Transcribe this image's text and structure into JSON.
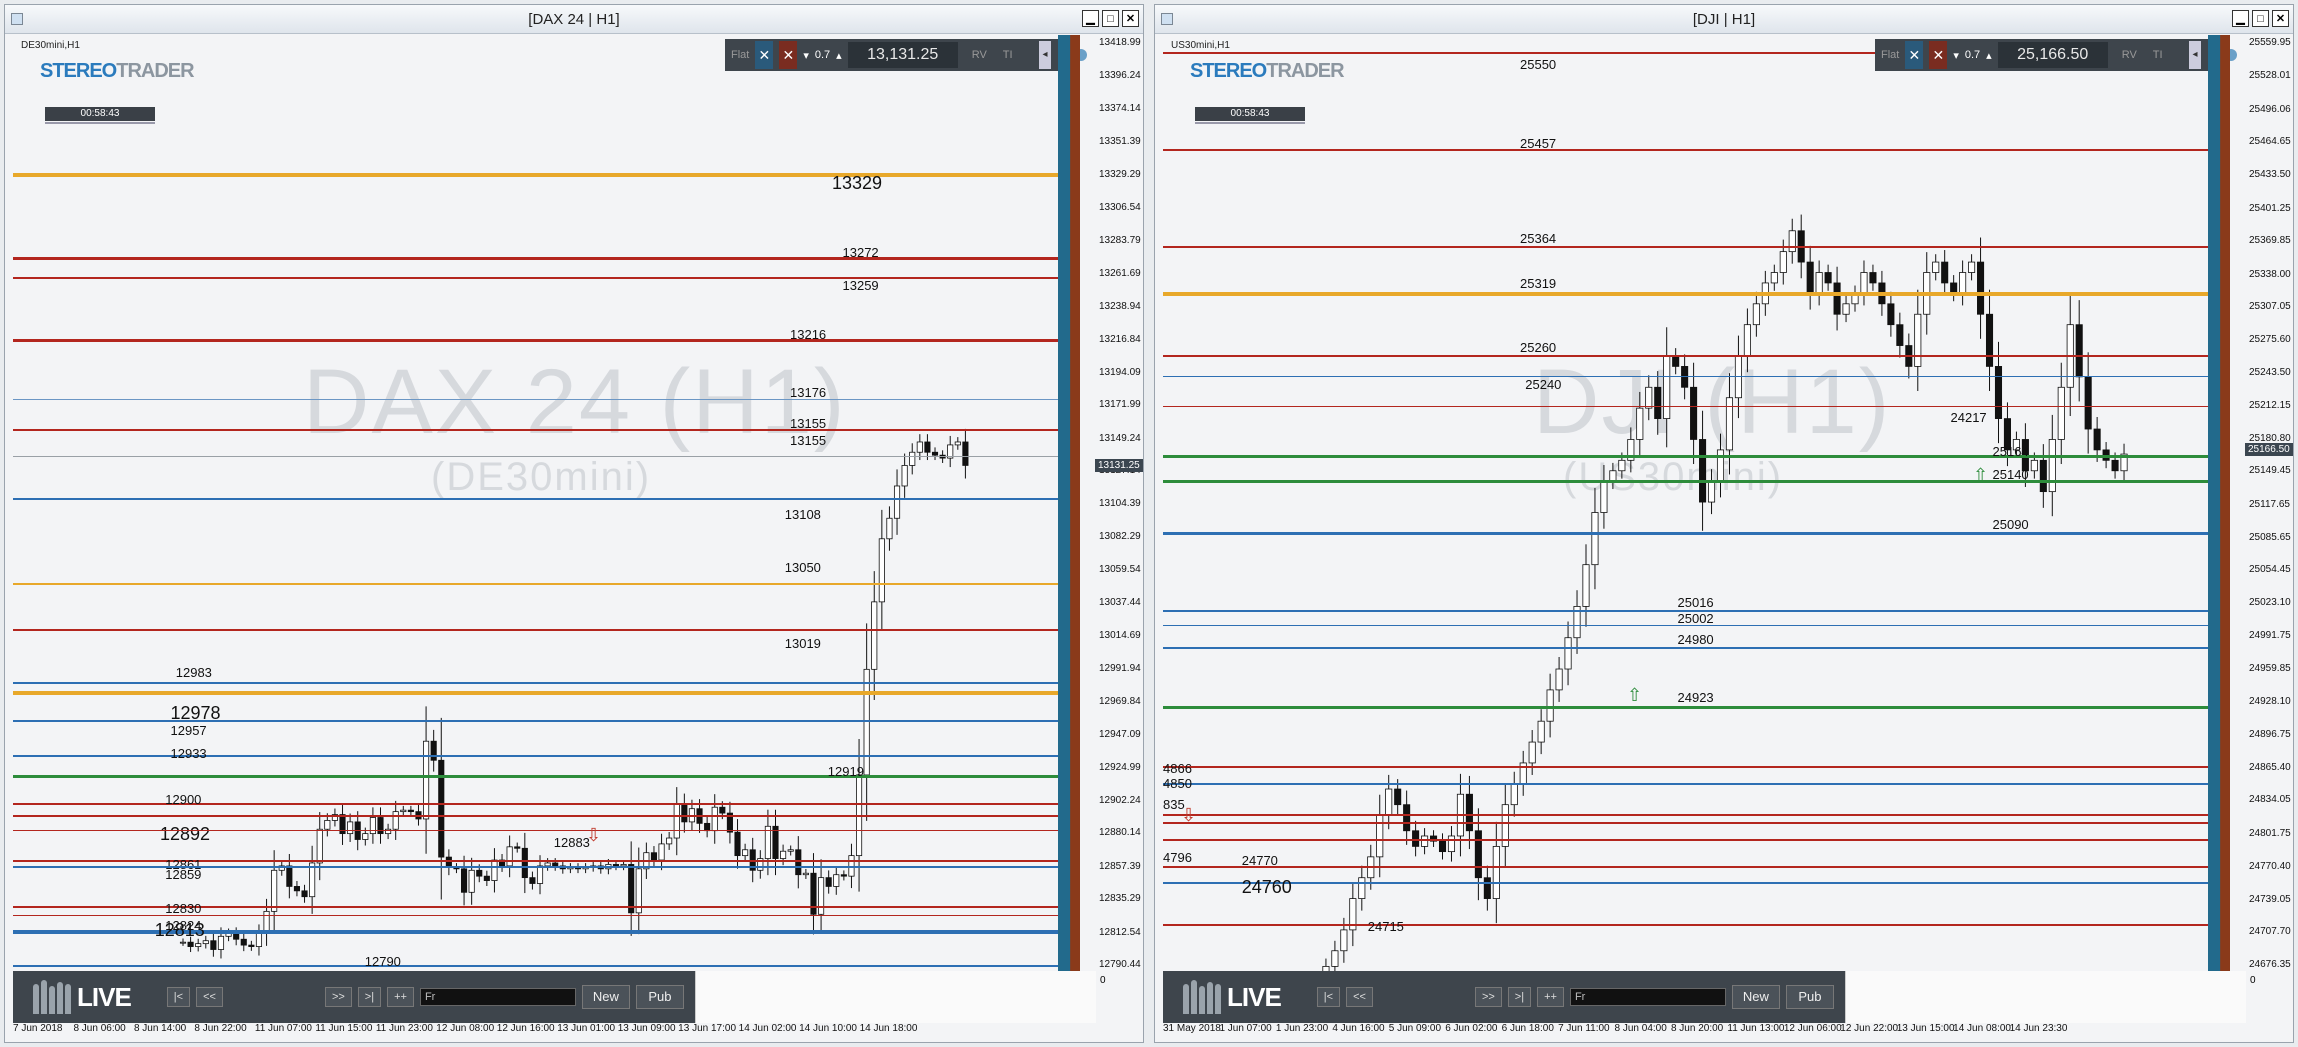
{
  "left": {
    "title": "[DAX 24 | H1]",
    "symbol_label": "DE30mini,H1",
    "watermark_main": "DAX 24 (H1)",
    "watermark_sub": "(DE30mini)",
    "timer": "00:58:43",
    "toolbar": {
      "flat": "Flat",
      "lot": "0.7",
      "price": "13,131.25",
      "rv": "RV",
      "tl": "TI"
    },
    "current_price_tag": "13131.25",
    "bottom": {
      "new": "New",
      "pub": "Pub",
      "field": "Fr",
      "live": "LIVE",
      "nav": [
        "|<",
        "<<",
        ">>",
        ">|",
        "++"
      ]
    },
    "levels": [
      {
        "label": "13329",
        "price": 13329,
        "color": "#e8a82a",
        "width": 4,
        "labelx": 0.78,
        "big": true,
        "ldy": -2
      },
      {
        "label": "13272",
        "price": 13272,
        "color": "#b3261e",
        "width": 3,
        "labelx": 0.79,
        "ldy": -14
      },
      {
        "label": "13259",
        "price": 13259,
        "color": "#b3261e",
        "width": 2,
        "labelx": 0.79,
        "ldy": 0
      },
      {
        "label": "13216",
        "price": 13216,
        "color": "#b3261e",
        "width": 3,
        "labelx": 0.74,
        "ldy": -14
      },
      {
        "label": "13176",
        "price": 13176,
        "color": "#6b96c4",
        "width": 1,
        "labelx": 0.74,
        "ldy": -14
      },
      {
        "label": "13155",
        "price": 13155,
        "color": "#b3261e",
        "width": 2,
        "labelx": 0.74,
        "ldy": -14
      },
      {
        "label": "13155",
        "price": 13137,
        "color": "#9aa0a6",
        "width": 1,
        "labelx": 0.74,
        "ldy": -24
      },
      {
        "label": "13108",
        "price": 13108,
        "color": "#2d6fb3",
        "width": 2,
        "labelx": 0.735,
        "ldy": 8
      },
      {
        "label": "13050",
        "price": 13050,
        "color": "#e8a82a",
        "width": 2,
        "labelx": 0.735,
        "ldy": -24
      },
      {
        "label": "13019",
        "price": 13019,
        "color": "#b3261e",
        "width": 2,
        "labelx": 0.735,
        "ldy": 6
      },
      {
        "label": "12983",
        "price": 12983,
        "color": "#2d6fb3",
        "width": 2,
        "labelx": 0.155,
        "ldy": -18
      },
      {
        "label": "12978",
        "price": 12976,
        "color": "#e8a82a",
        "width": 4,
        "labelx": 0.15,
        "big": true,
        "ldy": 10
      },
      {
        "label": "12957",
        "price": 12957,
        "color": "#2d6fb3",
        "width": 2,
        "labelx": 0.15,
        "ldy": 2
      },
      {
        "label": "12933",
        "price": 12933,
        "color": "#2d6fb3",
        "width": 2,
        "labelx": 0.15,
        "ldy": -10
      },
      {
        "label": "12919",
        "price": 12919,
        "color": "#2d8c3b",
        "width": 3,
        "labelx": 0.776,
        "ldy": -12
      },
      {
        "label": "12900",
        "price": 12900,
        "color": "#b3261e",
        "width": 2,
        "labelx": 0.145,
        "ldy": -12
      },
      {
        "label": "12892",
        "price": 12892,
        "color": "#b3261e",
        "width": 2,
        "labelx": 0.14,
        "big": true,
        "ldy": 8
      },
      {
        "label": "12883",
        "price": 12882,
        "color": "#b3261e",
        "width": 1,
        "labelx": 0.515,
        "ldy": 4
      },
      {
        "label": "12861",
        "price": 12861,
        "color": "#b3261e",
        "width": 2,
        "labelx": 0.145,
        "ldy": -4
      },
      {
        "label": "12859",
        "price": 12857,
        "color": "#2d6fb3",
        "width": 2,
        "labelx": 0.145,
        "ldy": 0
      },
      {
        "label": "12830",
        "price": 12830,
        "color": "#b3261e",
        "width": 2,
        "labelx": 0.145,
        "ldy": -6
      },
      {
        "label": "12824",
        "price": 12824,
        "color": "#b3261e",
        "width": 1,
        "labelx": 0.145,
        "ldy": 2
      },
      {
        "label": "12813",
        "price": 12813,
        "color": "#2d6fb3",
        "width": 4,
        "labelx": 0.135,
        "big": true,
        "ldy": -12
      },
      {
        "label": "12790",
        "price": 12790,
        "color": "#2d6fb3",
        "width": 2,
        "labelx": 0.335,
        "ldy": -12
      }
    ],
    "yaxis": [
      "13418.99",
      "13396.24",
      "13374.14",
      "13351.39",
      "13329.29",
      "13306.54",
      "13283.79",
      "13261.69",
      "13238.94",
      "13216.84",
      "13194.09",
      "13171.99",
      "13149.24",
      "13127.14",
      "13104.39",
      "13082.29",
      "13059.54",
      "13037.44",
      "13014.69",
      "12991.94",
      "12969.84",
      "12947.09",
      "12924.99",
      "12902.24",
      "12880.14",
      "12857.39",
      "12835.29",
      "12812.54",
      "12790.44"
    ],
    "xaxis": [
      "7 Jun 2018",
      "8 Jun 06:00",
      "8 Jun 14:00",
      "8 Jun 22:00",
      "11 Jun 07:00",
      "11 Jun 15:00",
      "11 Jun 23:00",
      "12 Jun 08:00",
      "12 Jun 16:00",
      "13 Jun 01:00",
      "13 Jun 09:00",
      "13 Jun 17:00",
      "14 Jun 02:00",
      "14 Jun 10:00",
      "14 Jun 18:00"
    ],
    "candles": [
      12806,
      12803,
      12805,
      12807,
      12801,
      12810,
      12812,
      12808,
      12804,
      12803,
      12812,
      12827,
      12855,
      12858,
      12844,
      12841,
      12837,
      12860,
      12883,
      12889,
      12893,
      12880,
      12888,
      12876,
      12880,
      12891,
      12880,
      12883,
      12895,
      12896,
      12895,
      12890,
      12943,
      12930,
      12864,
      12857,
      12856,
      12840,
      12855,
      12851,
      12848,
      12862,
      12858,
      12871,
      12870,
      12850,
      12846,
      12858,
      12860,
      12858,
      12856,
      12857,
      12856,
      12857,
      12858,
      12856,
      12859,
      12858,
      12859,
      12826,
      12856,
      12867,
      12862,
      12873,
      12877,
      12900,
      12888,
      12897,
      12887,
      12882,
      12898,
      12894,
      12881,
      12865,
      12869,
      12855,
      12863,
      12885,
      12863,
      12868,
      12869,
      12852,
      12853,
      12825,
      12850,
      12844,
      12852,
      12851,
      12865,
      12920,
      12992,
      13038,
      13081,
      13095,
      13117,
      13131,
      13140,
      13147,
      13140,
      13138,
      13136,
      13145,
      13147,
      13131
    ]
  },
  "right": {
    "title": "[DJI | H1]",
    "symbol_label": "US30mini,H1",
    "watermark_main": "DJI (H1)",
    "watermark_sub": "(US30mini)",
    "timer": "00:58:43",
    "toolbar": {
      "flat": "Flat",
      "lot": "0.7",
      "price": "25,166.50",
      "rv": "RV",
      "tl": "TI"
    },
    "current_price_tag": "25166.50",
    "bottom": {
      "new": "New",
      "pub": "Pub",
      "field": "Fr",
      "live": "LIVE",
      "nav": [
        "|<",
        "<<",
        ">>",
        ">|",
        "++"
      ]
    },
    "levels": [
      {
        "label": "25550",
        "price": 25550,
        "color": "#b3261e",
        "width": 2,
        "labelx": 0.34,
        "ldy": 4
      },
      {
        "label": "25457",
        "price": 25457,
        "color": "#b3261e",
        "width": 2,
        "labelx": 0.34,
        "ldy": -14
      },
      {
        "label": "25364",
        "price": 25364,
        "color": "#b3261e",
        "width": 2,
        "labelx": 0.34,
        "ldy": -16
      },
      {
        "label": "25319",
        "price": 25319,
        "color": "#e8a82a",
        "width": 4,
        "labelx": 0.34,
        "ldy": -18
      },
      {
        "label": "25260",
        "price": 25260,
        "color": "#b3261e",
        "width": 2,
        "labelx": 0.34,
        "ldy": -16
      },
      {
        "label": "25240",
        "price": 25240,
        "color": "#2d6fb3",
        "width": 1,
        "labelx": 0.345,
        "ldy": 0
      },
      {
        "label": "24217",
        "price": 25212,
        "color": "#b3261e",
        "width": 1,
        "labelx": 0.75,
        "ldy": 4
      },
      {
        "label": "25164",
        "price": 25164,
        "color": "#2d8c3b",
        "width": 3,
        "labelx": 0.79,
        "ldy": -12
      },
      {
        "label": "25140",
        "price": 25140,
        "color": "#2d8c3b",
        "width": 3,
        "labelx": 0.79,
        "ldy": -14
      },
      {
        "label": "25090",
        "price": 25090,
        "color": "#2d6fb3",
        "width": 3,
        "labelx": 0.79,
        "ldy": -16
      },
      {
        "label": "25016",
        "price": 25016,
        "color": "#2d6fb3",
        "width": 2,
        "labelx": 0.49,
        "ldy": -16
      },
      {
        "label": "25002",
        "price": 25002,
        "color": "#2d6fb3",
        "width": 1,
        "labelx": 0.49,
        "ldy": -14
      },
      {
        "label": "24980",
        "price": 24980,
        "color": "#2d6fb3",
        "width": 2,
        "labelx": 0.49,
        "ldy": -16
      },
      {
        "label": "24923",
        "price": 24923,
        "color": "#2d8c3b",
        "width": 3,
        "labelx": 0.49,
        "ldy": -18
      },
      {
        "label": "4866",
        "price": 24866,
        "color": "#b3261e",
        "width": 2,
        "labelx": 0.0,
        "ldy": -6
      },
      {
        "label": "4850",
        "price": 24850,
        "color": "#2d6fb3",
        "width": 2,
        "labelx": 0.0,
        "ldy": -8
      },
      {
        "label": "835",
        "price": 24820,
        "color": "#b3261e",
        "width": 2,
        "labelx": 0.0,
        "ldy": -18
      },
      {
        "label": "",
        "price": 24812,
        "color": "#b3261e",
        "width": 2,
        "labelx": 0.0,
        "ldy": 0
      },
      {
        "label": "4796",
        "price": 24796,
        "color": "#b3261e",
        "width": 2,
        "labelx": 0.0,
        "ldy": 10
      },
      {
        "label": "24770",
        "price": 24770,
        "color": "#b3261e",
        "width": 2,
        "labelx": 0.075,
        "ldy": -14
      },
      {
        "label": "24760",
        "price": 24755,
        "color": "#2d6fb3",
        "width": 2,
        "labelx": 0.075,
        "big": true,
        "ldy": -6
      },
      {
        "label": "24715",
        "price": 24715,
        "color": "#b3261e",
        "width": 2,
        "labelx": 0.195,
        "ldy": -6
      }
    ],
    "yaxis": [
      "25559.95",
      "25528.01",
      "25496.06",
      "25464.65",
      "25433.50",
      "25401.25",
      "25369.85",
      "25338.00",
      "25307.05",
      "25275.60",
      "25243.50",
      "25212.15",
      "25180.80",
      "25149.45",
      "25117.65",
      "25085.65",
      "25054.45",
      "25023.10",
      "24991.75",
      "24959.85",
      "24928.10",
      "24896.75",
      "24865.40",
      "24834.05",
      "24801.75",
      "24770.40",
      "24739.05",
      "24707.70",
      "24676.35"
    ],
    "xaxis": [
      "31 May 2018",
      "1 Jun 07:00",
      "1 Jun 23:00",
      "4 Jun 16:00",
      "5 Jun 09:00",
      "6 Jun 02:00",
      "6 Jun 18:00",
      "7 Jun 11:00",
      "8 Jun 04:00",
      "8 Jun 20:00",
      "11 Jun 13:00",
      "12 Jun 06:00",
      "12 Jun 22:00",
      "13 Jun 15:00",
      "14 Jun 08:00",
      "14 Jun 23:30"
    ],
    "candles": [
      24660,
      24665,
      24675,
      24690,
      24710,
      24740,
      24760,
      24780,
      24820,
      24845,
      24830,
      24805,
      24790,
      24800,
      24795,
      24785,
      24800,
      24840,
      24805,
      24760,
      24740,
      24790,
      24830,
      24850,
      24870,
      24890,
      24910,
      24940,
      24960,
      24990,
      25020,
      25060,
      25110,
      25140,
      25150,
      25160,
      25180,
      25210,
      25230,
      25200,
      25260,
      25250,
      25230,
      25180,
      25120,
      25140,
      25170,
      25220,
      25260,
      25290,
      25310,
      25330,
      25340,
      25360,
      25380,
      25350,
      25320,
      25340,
      25330,
      25300,
      25310,
      25320,
      25340,
      25330,
      25310,
      25290,
      25270,
      25250,
      25300,
      25340,
      25350,
      25330,
      25320,
      25340,
      25350,
      25300,
      25250,
      25200,
      25170,
      25180,
      25150,
      25160,
      25130,
      25180,
      25230,
      25290,
      25240,
      25190,
      25170,
      25160,
      25150,
      25166
    ]
  }
}
